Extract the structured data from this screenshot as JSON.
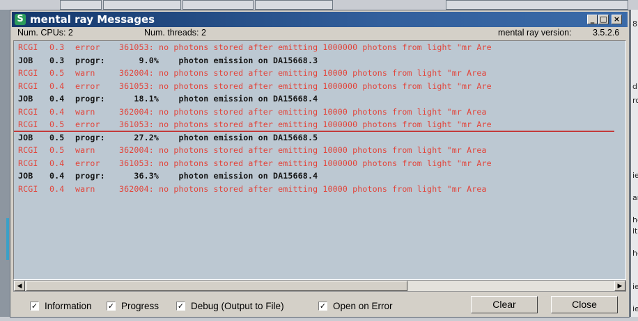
{
  "window": {
    "title": "mental ray Messages",
    "app_icon": "S",
    "controls": {
      "minimize": "_",
      "maximize": "□",
      "close": "×"
    }
  },
  "status": {
    "cpus": "Num. CPUs: 2",
    "threads": "Num. threads: 2",
    "version_label": "mental ray version:",
    "version": "3.5.2.6"
  },
  "log": [
    {
      "level": "error",
      "module": "RCGI",
      "thread": "0.3",
      "type": "error",
      "message": "361053: no photons stored after emitting 1000000 photons from light \"mr Are"
    },
    {
      "level": "info",
      "module": "JOB",
      "thread": "0.3",
      "type": "progr:",
      "message": "    9.0%    photon emission on DA15668.3"
    },
    {
      "level": "warn",
      "module": "RCGI",
      "thread": "0.5",
      "type": "warn",
      "message": "362004: no photons stored after emitting 10000 photons from light \"mr Area"
    },
    {
      "level": "error",
      "module": "RCGI",
      "thread": "0.4",
      "type": "error",
      "message": "361053: no photons stored after emitting 1000000 photons from light \"mr Are"
    },
    {
      "level": "info",
      "module": "JOB",
      "thread": "0.4",
      "type": "progr:",
      "message": "   18.1%    photon emission on DA15668.4"
    },
    {
      "level": "warn",
      "module": "RCGI",
      "thread": "0.4",
      "type": "warn",
      "message": "362004: no photons stored after emitting 10000 photons from light \"mr Area"
    },
    {
      "level": "error",
      "module": "RCGI",
      "thread": "0.5",
      "type": "error",
      "message": "361053: no photons stored after emitting 1000000 photons from light \"mr Are"
    },
    {
      "level": "info",
      "module": "JOB",
      "thread": "0.5",
      "type": "progr:",
      "message": "   27.2%    photon emission on DA15668.5"
    },
    {
      "level": "warn",
      "module": "RCGI",
      "thread": "0.5",
      "type": "warn",
      "message": "362004: no photons stored after emitting 10000 photons from light \"mr Area"
    },
    {
      "level": "error",
      "module": "RCGI",
      "thread": "0.4",
      "type": "error",
      "message": "361053: no photons stored after emitting 1000000 photons from light \"mr Are"
    },
    {
      "level": "info",
      "module": "JOB",
      "thread": "0.4",
      "type": "progr:",
      "message": "   36.3%    photon emission on DA15668.4"
    },
    {
      "level": "warn",
      "module": "RCGI",
      "thread": "0.4",
      "type": "warn",
      "message": "362004: no photons stored after emitting 10000 photons from light \"mr Area"
    }
  ],
  "scrollbar": {
    "left_arrow": "◀",
    "right_arrow": "▶"
  },
  "options": {
    "information": "Information",
    "progress": "Progress",
    "debug": "Debug (Output to File)",
    "open_on_error": "Open on Error",
    "checkmark": "✓"
  },
  "buttons": {
    "clear": "Clear",
    "close": "Close"
  },
  "background_fragments": [
    "8",
    "d",
    "rc",
    "ie",
    "ar",
    "he",
    "ith",
    "he",
    "ie",
    "ie"
  ],
  "colors": {
    "error_text": "#e2443a",
    "log_background": "#bcc8d2",
    "titlebar": "#1f4a86"
  }
}
